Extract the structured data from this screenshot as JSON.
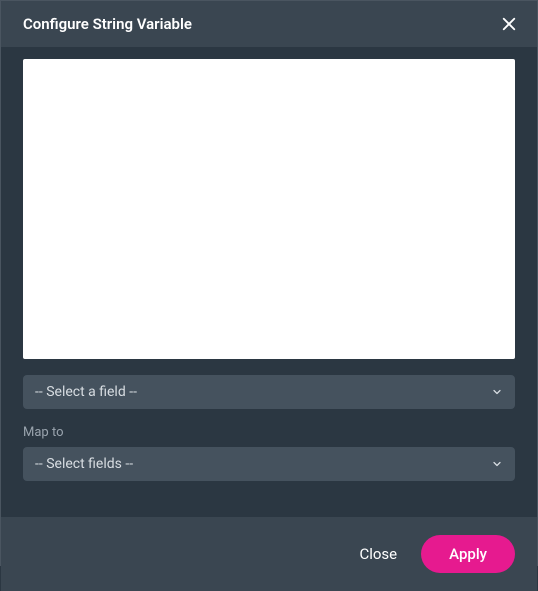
{
  "dialog": {
    "title": "Configure String Variable",
    "fieldSelect": {
      "selected": "-- Select a field --"
    },
    "mapTo": {
      "label": "Map to",
      "selected": "-- Select fields --"
    },
    "footer": {
      "close": "Close",
      "apply": "Apply"
    }
  }
}
